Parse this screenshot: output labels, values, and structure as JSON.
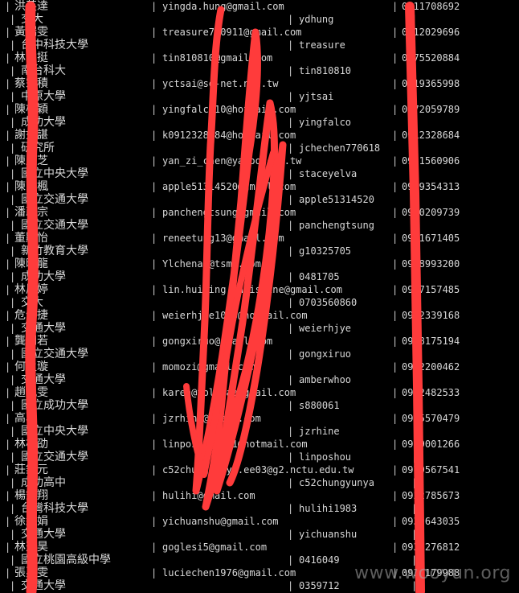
{
  "terminal": {
    "rows": [
      {
        "name": "洪英達",
        "email": "yingda.hung@gmail.com",
        "phone": "0911708692",
        "school": "交大",
        "user": "ydhung"
      },
      {
        "name": "黃瑞雯",
        "email": "treasure750911@gmail.com",
        "phone": "0912029696",
        "school": "台中科技大學",
        "user": "treasure"
      },
      {
        "name": "林才挺",
        "email": "tin810810@gmail.com",
        "phone": "0975520884",
        "school": "南台科大",
        "user": "tin810810"
      },
      {
        "name": "蔡宗積",
        "email": "yctsai@so-net.net.tw",
        "phone": "0919365998",
        "school": "中原大學",
        "user": "yjtsai"
      },
      {
        "name": "陳柏穎",
        "email": "yingfalco10@hotmail.com",
        "phone": "0972059789",
        "school": "成功大學",
        "user": "yingfalco"
      },
      {
        "name": "謝如諶",
        "email": "k0912328684@hotmail.com",
        "phone": "0912328684",
        "school": "研究所",
        "user": "jchechen770618"
      },
      {
        "name": "陳彥芝",
        "email": "yan_zi_chen@yahoo.com.tw",
        "phone": "0931560906",
        "school": "國立中央大學",
        "user": "staceyelva"
      },
      {
        "name": "陳咏楓",
        "email": "apple51314520@gmail.com",
        "phone": "0909354313",
        "school": "國立交通大學",
        "user": "apple51314520"
      },
      {
        "name": "潘政宗",
        "email": "panchengtsung@gmail.com",
        "phone": "0930209739",
        "school": "國立交通大學",
        "user": "panchengtsung"
      },
      {
        "name": "董顯怡",
        "email": "reneetung13@gmail.com",
        "phone": "0911671405",
        "school": "新竹教育大學",
        "user": "g10325705"
      },
      {
        "name": "陳映龍",
        "email": "Ylchenap@tsmc.com",
        "phone": "0988993200",
        "school": "成功大學",
        "user": "0481705"
      },
      {
        "name": "林鳳婷",
        "email": "lin.huiting.christine@gmail.com",
        "phone": "0937157485",
        "school": "交大",
        "user": "0703560860"
      },
      {
        "name": "危俊捷",
        "email": "weierhjye1003@hotmail.com",
        "phone": "0972339168",
        "school": "交通大學",
        "user": "weierhjye"
      },
      {
        "name": "龔栩若",
        "email": "gongxiruo@gmail.com",
        "phone": "0988175194",
        "school": "國立交通大學",
        "user": "gongxiruo"
      },
      {
        "name": "何孟璇",
        "email": "momozi@gmail.com",
        "phone": "0922200462",
        "school": "交通大學",
        "user": "amberwhoo"
      },
      {
        "name": "趙珮雯",
        "email": "karen@yolahaa@gmail.com",
        "phone": "0922482533",
        "school": "國立成功大學",
        "user": "s880061"
      },
      {
        "name": "高羽",
        "email": "jzrhine@gmail.com",
        "phone": "0905570479",
        "school": "國立中央大學",
        "user": "jzrhine"
      },
      {
        "name": "林柏劭",
        "email": "linposhou1991@hotmail.com",
        "phone": "0939001266",
        "school": "國立交通大學",
        "user": "linposhou"
      },
      {
        "name": "莊鈞元",
        "email": "c52chungyunya.ee03@g2.nctu.edu.tw",
        "phone": "0979567541",
        "school": "成功高中",
        "user": "c52chungyunya"
      },
      {
        "name": "楊鈞翔",
        "email": "hulihi@gmail.com",
        "phone": "0922785673",
        "school": "台灣科技大學",
        "user": "hulihi1983"
      },
      {
        "name": "徐綺娟",
        "email": "yichuanshu@gmail.com",
        "phone": "0939643035",
        "school": "交通大學",
        "user": "yichuanshu"
      },
      {
        "name": "林冠昊",
        "email": "goglesi5@gmail.com",
        "phone": "0932276812",
        "school": "國立桃園高級中學",
        "user": "0416049"
      },
      {
        "name": "張嘉雯",
        "email": "luciechen1976@gmail.com",
        "phone": "0932179988",
        "school": "交通大學",
        "user": "0359712"
      }
    ]
  },
  "scribble": {
    "color": "#ff3b3b"
  },
  "watermark": "www.wooyun.org"
}
